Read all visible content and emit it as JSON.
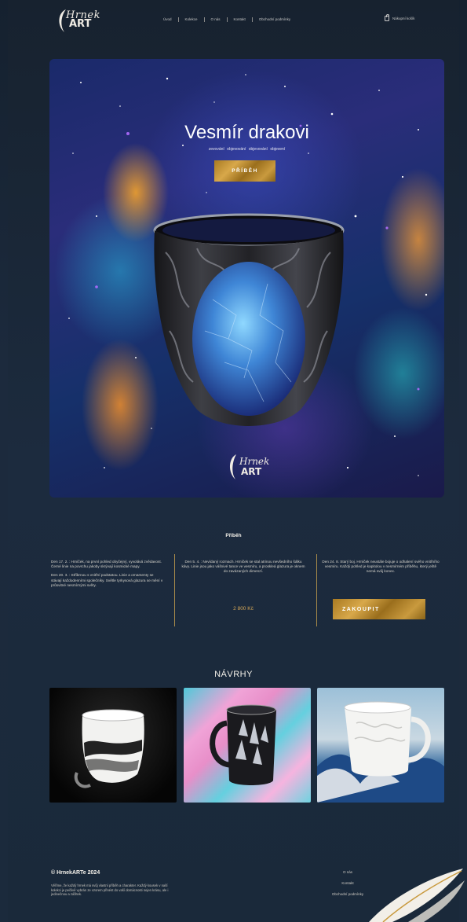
{
  "brand": {
    "logo_script": "Hrnek",
    "logo_art": "ART"
  },
  "nav": {
    "items": [
      "Úvod",
      "Kolekce",
      "O nás",
      "Kontakt",
      "Obchodní podmínky"
    ],
    "cart_label": "Nákupní košík"
  },
  "hero": {
    "title": "Vesmír drakovi",
    "subtitle": "zevování   objevování   objevování   objevení",
    "button_label": "PŘÍBĚH"
  },
  "story": {
    "title": "Příběh",
    "col1_p1": "Den 17. 2. : Hrníček, na první pohled obyčejný, vyvolává zvědavost. Černé linie na povrchu jakoby skrývají kosmické mapy.",
    "col1_p2": "Den 20. 3. : Stříbrnou s vnitřní podstatou. Linie a ornamenty se stávají každodenními společníky. Světle tyrkysová glazura se mění v průsvitné nesmírnými světy.",
    "col2_p1": "Den 5. 4. : Nevídaný rozmach. Hrníček se stal atrinou nevšedního šálku kávy. Linie jsou jako vášnivé tance ve vesmíru, a proskleá glazura je oknem do zavázaných dimenzí.",
    "col3_p1": "Den 24. 8. Starý boj. Hrníček neustále bojuje o odhalení svého vnitřního vesmíru. Každý pohled je kapitolou v nesmírném příběhu, který ještě nemá svůj konec.",
    "price": "2 800 Kč",
    "buy_label": "ZAKOUPIT"
  },
  "designs": {
    "title": "NÁVRHY"
  },
  "footer": {
    "copyright": "© HrnekARTe 2024",
    "text": "Věříme, že každý hrnek má svůj vlastní příběh a charakter. Každý kousek v naší kolekci je pečlivě vybrán ze vzorem přinést do vaší domácnosti nejen krásu, ale i jedinečnou a zážitek.",
    "links": [
      "O nás",
      "Kontakt",
      "Obchodní podmínky"
    ]
  }
}
